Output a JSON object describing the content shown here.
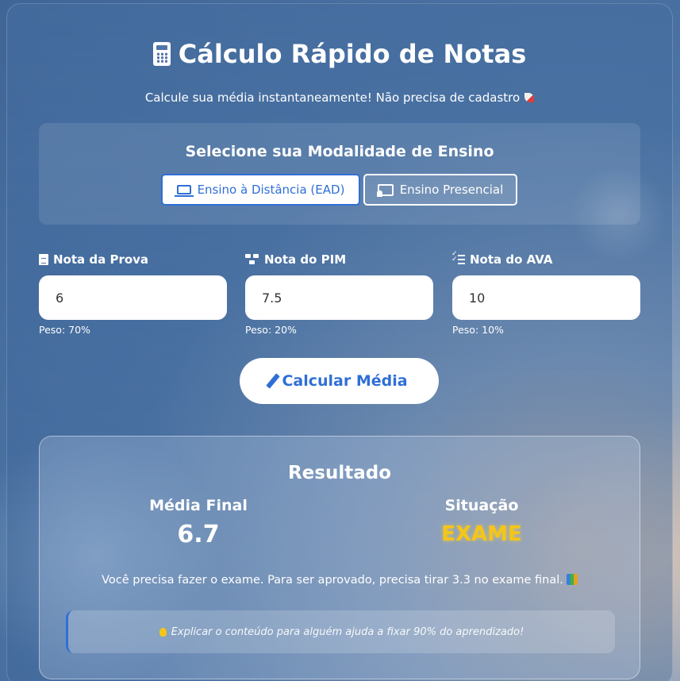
{
  "header": {
    "title": "Cálculo Rápido de Notas",
    "subtitle": "Calcule sua média instantaneamente! Não precisa de cadastro",
    "title_icon": "calculator-icon",
    "subtitle_icon": "rocket-icon"
  },
  "modality": {
    "title": "Selecione sua Modalidade de Ensino",
    "options": [
      {
        "label": "Ensino à Distância (EAD)",
        "icon": "laptop-icon",
        "selected": true
      },
      {
        "label": "Ensino Presencial",
        "icon": "chalkboard-teacher-icon",
        "selected": false
      }
    ]
  },
  "fields": [
    {
      "label": "Nota da Prova",
      "value": "6",
      "weight": "Peso: 70%",
      "icon": "file-icon"
    },
    {
      "label": "Nota do PIM",
      "value": "7.5",
      "weight": "Peso: 20%",
      "icon": "network-icon"
    },
    {
      "label": "Nota do AVA",
      "value": "10",
      "weight": "Peso: 10%",
      "icon": "tasks-icon"
    }
  ],
  "calculate_button": {
    "label": "Calcular Média",
    "icon": "pencil-icon"
  },
  "result": {
    "title": "Resultado",
    "average_label": "Média Final",
    "average_value": "6.7",
    "status_label": "Situação",
    "status_value": "EXAME",
    "message": "Você precisa fazer o exame. Para ser aprovado, precisa tirar 3.3 no exame final.",
    "tip": "Explicar o conteúdo para alguém ajuda a fixar 90% do aprendizado!"
  },
  "colors": {
    "accent": "#2f6fd6",
    "exam": "#f5c518"
  }
}
